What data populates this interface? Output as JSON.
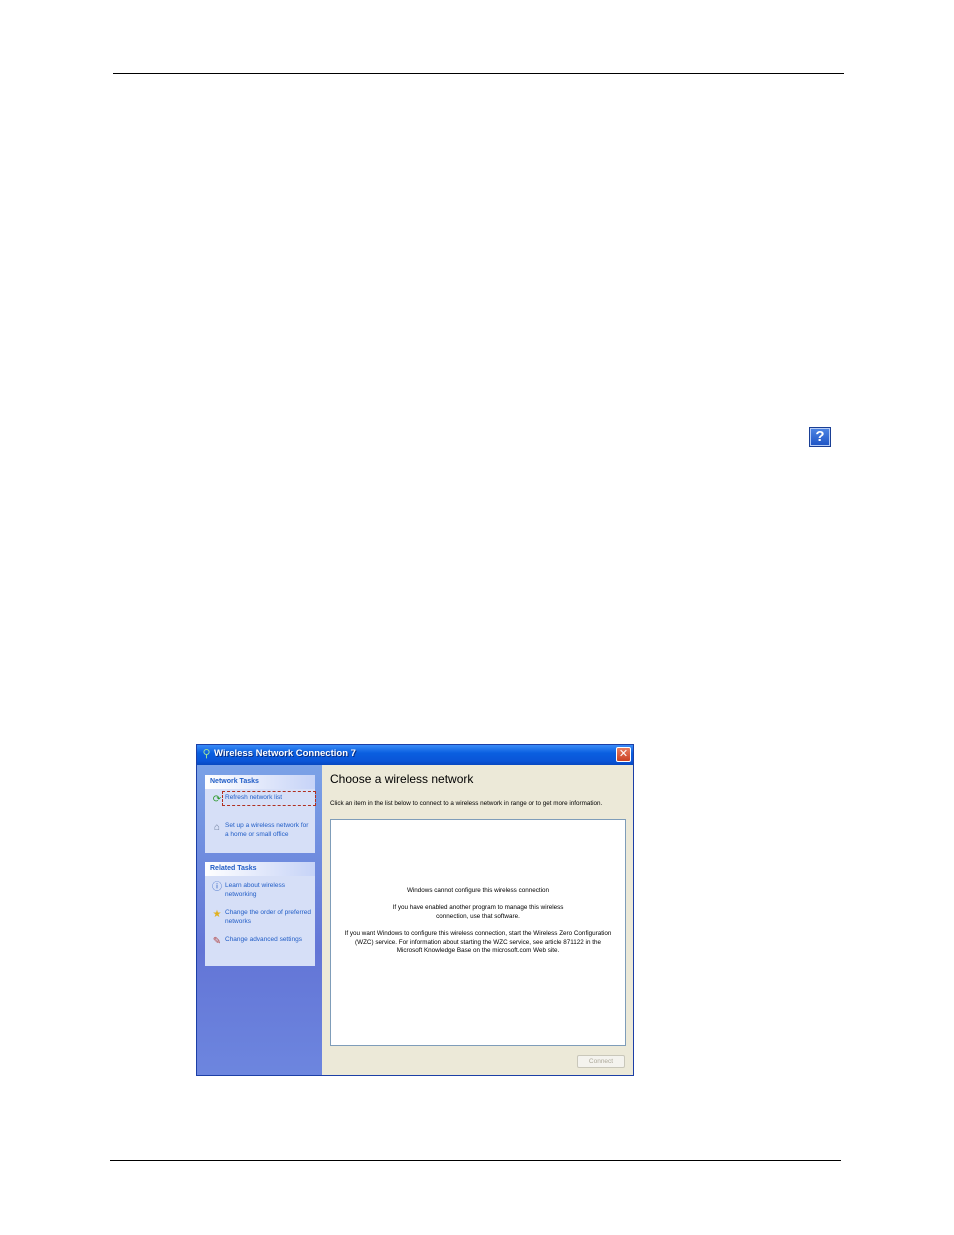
{
  "window": {
    "title": "Wireless Network Connection 7",
    "close_symbol": "✕"
  },
  "help_icon": {
    "symbol": "?"
  },
  "sidebar": {
    "network_tasks": {
      "heading": "Network Tasks",
      "items": [
        {
          "label": "Refresh network list",
          "icon": "refresh-icon"
        },
        {
          "label": "Set up a wireless network for a home or small office",
          "icon": "wireless-setup-icon"
        }
      ]
    },
    "related_tasks": {
      "heading": "Related Tasks",
      "items": [
        {
          "label": "Learn about wireless networking",
          "icon": "info-icon"
        },
        {
          "label": "Change the order of preferred networks",
          "icon": "star-icon"
        },
        {
          "label": "Change advanced settings",
          "icon": "settings-icon"
        }
      ]
    }
  },
  "main": {
    "heading": "Choose a wireless network",
    "instruction": "Click an item in the list below to connect to a wireless network in range or to get more information.",
    "messages": {
      "line1": "Windows cannot configure this wireless connection",
      "line2": "If you have enabled another program to manage this wireless connection, use that software.",
      "line3": "If you want Windows to configure this wireless connection, start the Wireless Zero Configuration (WZC) service. For information about starting the WZC service, see article 871122 in the Microsoft Knowledge Base on the microsoft.com Web site."
    },
    "connect_label": "Connect"
  }
}
